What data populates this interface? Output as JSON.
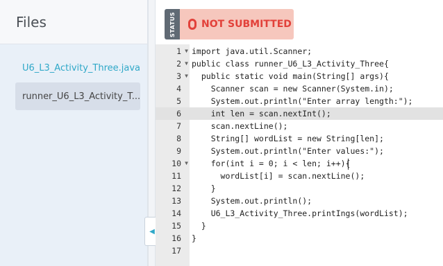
{
  "sidebar": {
    "title": "Files",
    "files": [
      {
        "label": "U6_L3_Activity_Three.java",
        "state": "link"
      },
      {
        "label": "runner_U6_L3_Activity_T...",
        "state": "active"
      }
    ],
    "collapse_icon": "triangle-left-icon"
  },
  "status": {
    "label": "STATUS",
    "value": "NOT SUBMITTED",
    "icon": "stop-icon",
    "color": "#e2413a",
    "background": "#f6c7bd"
  },
  "editor": {
    "active_line": 6,
    "lines": [
      {
        "n": "1",
        "fold": true,
        "text": "import java.util.Scanner;"
      },
      {
        "n": "2",
        "fold": true,
        "text": "public class runner_U6_L3_Activity_Three{"
      },
      {
        "n": "3",
        "fold": true,
        "text": "  public static void main(String[] args){"
      },
      {
        "n": "4",
        "fold": false,
        "text": "    Scanner scan = new Scanner(System.in);"
      },
      {
        "n": "5",
        "fold": false,
        "text": "    System.out.println(\"Enter array length:\");"
      },
      {
        "n": "6",
        "fold": false,
        "text": "    int len = scan.nextInt();"
      },
      {
        "n": "7",
        "fold": false,
        "text": "    scan.nextLine();"
      },
      {
        "n": "8",
        "fold": false,
        "text": "    String[] wordList = new String[len];"
      },
      {
        "n": "9",
        "fold": false,
        "text": "    System.out.println(\"Enter values:\");"
      },
      {
        "n": "10",
        "fold": true,
        "text": "    for(int i = 0; i < len; i++){"
      },
      {
        "n": "11",
        "fold": false,
        "text": "      wordList[i] = scan.nextLine();"
      },
      {
        "n": "12",
        "fold": false,
        "text": "    }"
      },
      {
        "n": "13",
        "fold": false,
        "text": "    System.out.println();"
      },
      {
        "n": "14",
        "fold": false,
        "text": "    U6_L3_Activity_Three.printIngs(wordList);"
      },
      {
        "n": "15",
        "fold": false,
        "text": "  }"
      },
      {
        "n": "16",
        "fold": false,
        "text": "}"
      },
      {
        "n": "17",
        "fold": false,
        "text": ""
      }
    ]
  }
}
